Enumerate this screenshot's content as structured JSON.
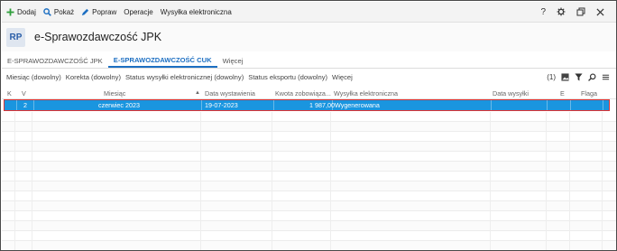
{
  "toolbar": {
    "add_label": "Dodaj",
    "show_label": "Pokaż",
    "edit_label": "Popraw",
    "operations_label": "Operacje",
    "efiling_label": "Wysyłka elektroniczna",
    "help_label": "?",
    "colors": {
      "add": "#2e9e3a",
      "search": "#1d6fc2",
      "edit": "#1d6fc2"
    }
  },
  "header": {
    "app_icon": "RP",
    "title": "e-Sprawozdawczość JPK"
  },
  "tabs": [
    {
      "label": "E-SPRAWOZDAWCZOŚĆ JPK",
      "active": false
    },
    {
      "label": "E-SPRAWOZDAWCZOŚĆ CUK",
      "active": true
    },
    {
      "label": "Więcej",
      "active": false
    }
  ],
  "filters": [
    "Miesiąc (dowolny)",
    "Korekta (dowolny)",
    "Status wysyłki elektronicznej (dowolny)",
    "Status eksportu (dowolny)",
    "Więcej"
  ],
  "filter_count": "(1)",
  "columns": {
    "k": "K",
    "v": "V",
    "month": "Miesiąc",
    "issue_date": "Data wystawienia",
    "amount": "Kwota zobowiąza...",
    "efiling": "Wysyłka elektroniczna",
    "send_date": "Data wysyłki",
    "e": "E",
    "flag": "Flaga"
  },
  "rows": [
    {
      "k": "",
      "v": "2",
      "month": "czerwiec 2023",
      "issue_date": "19-07-2023",
      "amount": "1 987,00",
      "efiling": "Wygenerowana",
      "send_date": "",
      "e": "",
      "flag": ""
    }
  ],
  "accent_color": "#1d6fc2",
  "selection_color": "#1a95df"
}
